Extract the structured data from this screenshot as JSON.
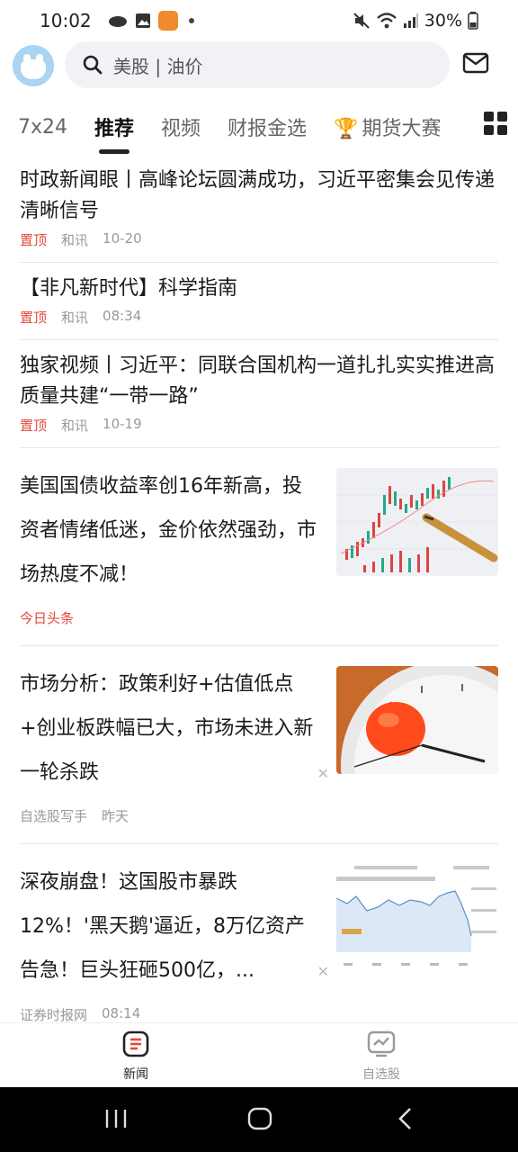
{
  "status_bar": {
    "time": "10:02",
    "battery": "30%"
  },
  "search": {
    "placeholder": "美股 | 油价"
  },
  "tabs": [
    {
      "label": "7x24"
    },
    {
      "label": "推荐"
    },
    {
      "label": "视频"
    },
    {
      "label": "财报金选"
    },
    {
      "label": "期货大赛"
    }
  ],
  "feed": {
    "pinned": [
      {
        "title": "时政新闻眼丨高峰论坛圆满成功，习近平密集会见传递清晰信号",
        "tag": "置顶",
        "source": "和讯",
        "time": "10-20"
      },
      {
        "title": "【非凡新时代】科学指南",
        "tag": "置顶",
        "source": "和讯",
        "time": "08:34"
      },
      {
        "title": "独家视频丨习近平：同联合国机构一道扎扎实实推进高质量共建“一带一路”",
        "tag": "置顶",
        "source": "和讯",
        "time": "10-19"
      }
    ],
    "articles": [
      {
        "title": "美国国债收益率创16年新高，投资者情绪低迷，金价依然强劲，市场热度不减！",
        "source": "今日头条",
        "time": ""
      },
      {
        "title": "市场分析：政策利好+估值低点+创业板跌幅已大，市场未进入新一轮杀跌",
        "source": "自选股写手",
        "time": "昨天"
      },
      {
        "title": "深夜崩盘！这国股市暴跌12%！'黑天鹅'逼近，8万亿资产告急！巨头狂砸500亿，...",
        "source": "证券时报网",
        "time": "08:14"
      }
    ]
  },
  "bottom_nav": [
    {
      "label": "新闻"
    },
    {
      "label": "自选股"
    }
  ],
  "colors": {
    "pin": "#e34a3c",
    "source_highlight": "#e34a3c",
    "accent": "#222222"
  }
}
